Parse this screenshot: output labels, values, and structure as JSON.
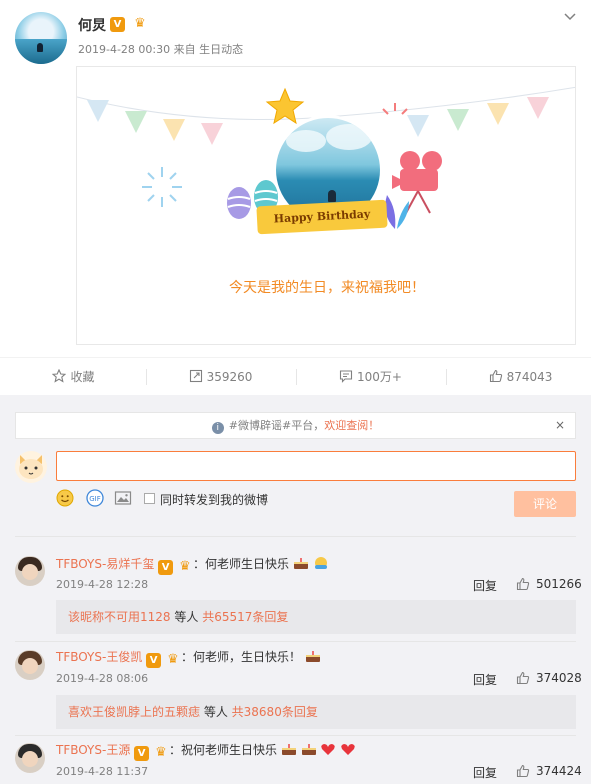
{
  "post": {
    "user_name": "何炅",
    "verified_badge": "V",
    "meta": "2019-4-28 00:30 来自 生日动态",
    "card_banner": "Happy Birthday",
    "card_text": "今天是我的生日，来祝福我吧！",
    "icons": [
      "avatar",
      "verified-badge",
      "crown-icon",
      "chevron-down-icon",
      "star-icon",
      "movie-camera-icon",
      "easter-egg-icon"
    ]
  },
  "actions": {
    "favorite": "收藏",
    "repost": "359260",
    "comment": "100万+",
    "like": "874043"
  },
  "notice": {
    "prefix": "#微博辟谣#平台，",
    "link": "欢迎查阅！",
    "close": "×"
  },
  "composer": {
    "checkbox_label": "同时转发到我的微博",
    "submit_label": "评论",
    "icons": [
      "emoji-icon",
      "gif-icon",
      "image-icon"
    ]
  },
  "comments": [
    {
      "name": "TFBOYS-易烊千玺",
      "text": "：何老师生日快乐",
      "time": "2019-4-28 12:28",
      "reply": "回复",
      "likes": "501266",
      "sub_link": "该昵称不可用1128",
      "sub_mid": " 等人 ",
      "sub_count": "共65517条回复"
    },
    {
      "name": "TFBOYS-王俊凯",
      "text": "：何老师，生日快乐！",
      "time": "2019-4-28 08:06",
      "reply": "回复",
      "likes": "374028",
      "sub_link": "喜欢王俊凯脖上的五颗痣",
      "sub_mid": " 等人 ",
      "sub_count": "共38680条回复"
    },
    {
      "name": "TFBOYS-王源",
      "text": "：祝何老师生日快乐",
      "time": "2019-4-28 11:37",
      "reply": "回复",
      "likes": "374424"
    }
  ],
  "colors": {
    "accent_orange": "#eb7350",
    "card_text": "#f28b25",
    "badge": "#f09a0e",
    "submit_disabled": "#ffc09f"
  }
}
